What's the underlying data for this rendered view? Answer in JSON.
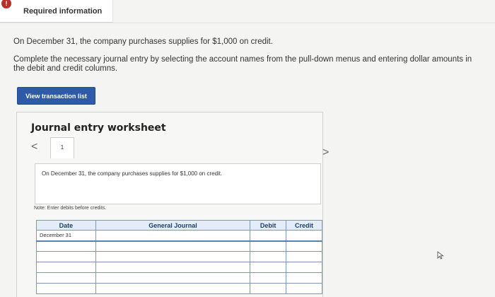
{
  "header": {
    "badge": "!",
    "title": "Required information"
  },
  "intro": {
    "line1": "On December 31, the company purchases supplies for $1,000 on credit.",
    "line2": "Complete the necessary journal entry by selecting the account names from the pull-down menus and entering dollar amounts in the debit and credit columns."
  },
  "actions": {
    "view_transaction_list": "View transaction list"
  },
  "worksheet": {
    "title": "Journal entry worksheet",
    "nav_prev": "<",
    "nav_next": ">",
    "tabs": [
      "1"
    ],
    "description": "On December 31, the company purchases supplies for $1,000 on credit.",
    "note": "Note: Enter debits before credits.",
    "columns": {
      "date": "Date",
      "general_journal": "General Journal",
      "debit": "Debit",
      "credit": "Credit"
    },
    "rows": [
      {
        "date": "December 31",
        "account": "",
        "debit": "",
        "credit": ""
      },
      {
        "date": "",
        "account": "",
        "debit": "",
        "credit": ""
      },
      {
        "date": "",
        "account": "",
        "debit": "",
        "credit": ""
      },
      {
        "date": "",
        "account": "",
        "debit": "",
        "credit": ""
      },
      {
        "date": "",
        "account": "",
        "debit": "",
        "credit": ""
      },
      {
        "date": "",
        "account": "",
        "debit": "",
        "credit": ""
      }
    ]
  }
}
